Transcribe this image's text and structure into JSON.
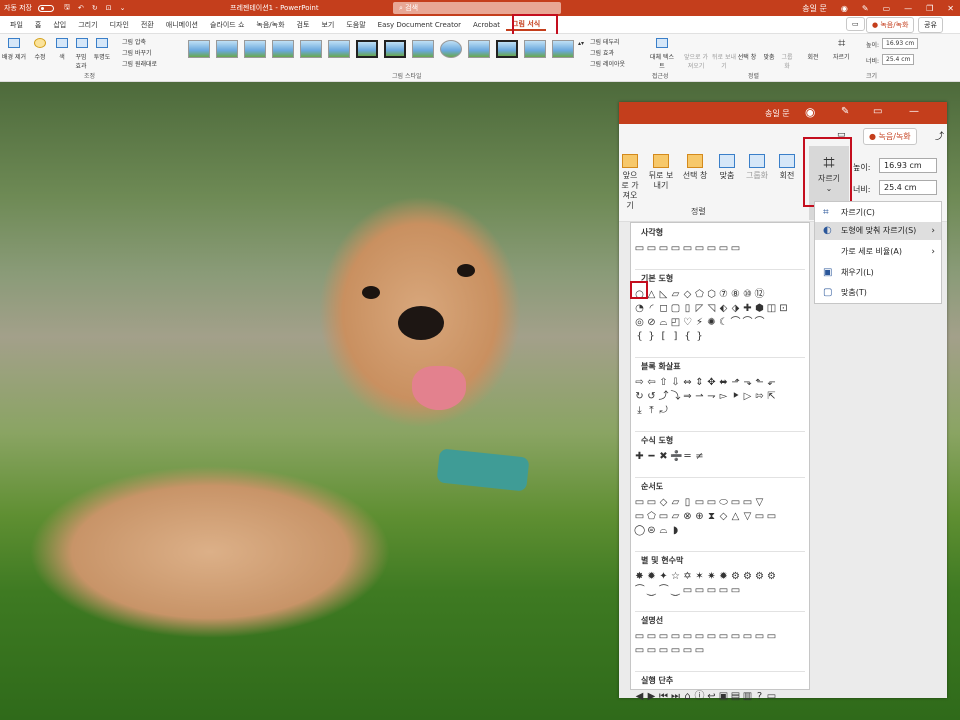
{
  "titlebar": {
    "autosave": "자동 저장",
    "toggle_state": "off",
    "file_title": "프레젠테이션1 - PowerPoint",
    "search_placeholder": "검색",
    "user": "송일 문"
  },
  "tabs": [
    "파일",
    "홈",
    "삽입",
    "그리기",
    "디자인",
    "전환",
    "애니메이션",
    "슬라이드 쇼",
    "녹음/녹화",
    "검토",
    "보기",
    "도움말",
    "Easy Document Creator",
    "Acrobat",
    "그림 서식"
  ],
  "active_tab": "그림 서식",
  "tab_buttons": {
    "record": "● 녹음/녹화",
    "share": "공유"
  },
  "ribbon": {
    "adjust_items": [
      "배경 제거",
      "수정",
      "색",
      "꾸밈 효과",
      "투명도"
    ],
    "adjust_small": [
      "그림 압축",
      "그림 바꾸기",
      "그림 원래대로"
    ],
    "group_adjust": "조정",
    "group_styles": "그림 스타일",
    "style_options": [
      "그림 테두리",
      "그림 효과",
      "그림 레이아웃"
    ],
    "accessibility": "대체 텍스트",
    "group_accessibility": "접근성",
    "arrange_items": [
      "앞으로 가져오기",
      "뒤로 보내기",
      "선택 창",
      "맞춤",
      "그룹화",
      "회전"
    ],
    "group_arrange": "정렬",
    "crop_label": "자르기",
    "height_label": "높이:",
    "height_value": "16.93 cm",
    "width_label": "너비:",
    "width_value": "25.4 cm",
    "group_size": "크기"
  },
  "inset": {
    "user": "송일 문",
    "record_button": "● 녹음/녹화",
    "arrange": [
      "앞으로 가져오기",
      "뒤로 보내기",
      "선택 창",
      "맞춤",
      "그룹화",
      "회전"
    ],
    "group_arrange": "정렬",
    "crop_label": "자르기",
    "height_label": "높이:",
    "height_value": "16.93 cm",
    "width_label": "너비:",
    "width_value": "25.4 cm"
  },
  "shape_categories": [
    {
      "name": "사각형",
      "rows": [
        "▭▭▭▭▭▭▭▭▭"
      ]
    },
    {
      "name": "기본 도형",
      "rows": [
        "○△◺▱◇⬠⬡⑦⑧⑩⑫",
        "◔◜◻▢▯◸◹⬖⬗✚⬢◫⊡",
        "◎⊘⌓◰♡⚡✺☾⌒⌒⌒",
        "{}[]{}"
      ]
    },
    {
      "name": "블록 화살표",
      "rows": [
        "⇨⇦⇧⇩⇔⇕✥⬌⬏⬎⬑⬐",
        "↻↺⤴⤵⇒⇀⇁▻⯈▷⇰⇱",
        "⤓⤒⤾"
      ]
    },
    {
      "name": "수식 도형",
      "rows": [
        "✚━✖➗═≠"
      ]
    },
    {
      "name": "순서도",
      "rows": [
        "▭▭◇▱▯▭▭⬭▭▭▽",
        "▭⬠▭▱⊗⊕⧗◇△▽▭▭",
        "◯⊜⌓◗"
      ]
    },
    {
      "name": "별 및 현수막",
      "rows": [
        "✸✹✦☆✡✶✷✹⚙⚙⚙⚙",
        "⏜⏝⏜⏝▭▭▭▭▭"
      ]
    },
    {
      "name": "설명선",
      "rows": [
        "▭▭▭▭▭▭▭▭▭▭▭▭",
        "▭▭▭▭▭▭"
      ]
    },
    {
      "name": "실행 단추",
      "rows": [
        "◀▶⏮⏭⌂ⓘ↩▣▤▥?▭"
      ]
    }
  ],
  "crop_menu": [
    {
      "label": "자르기(C)",
      "icon": "crop-icon",
      "submenu": false,
      "highlight": false
    },
    {
      "label": "도형에 맞춰 자르기(S)",
      "icon": "shape-crop-icon",
      "submenu": true,
      "highlight": true
    },
    {
      "label": "가로 세로 비율(A)",
      "icon": "",
      "submenu": true,
      "highlight": false
    },
    {
      "label": "채우기(L)",
      "icon": "fill-icon",
      "submenu": false,
      "highlight": false
    },
    {
      "label": "맞춤(T)",
      "icon": "fit-icon",
      "submenu": false,
      "highlight": false
    }
  ],
  "colors": {
    "accent": "#c43e1c",
    "highlight_box": "#c40e1e"
  }
}
